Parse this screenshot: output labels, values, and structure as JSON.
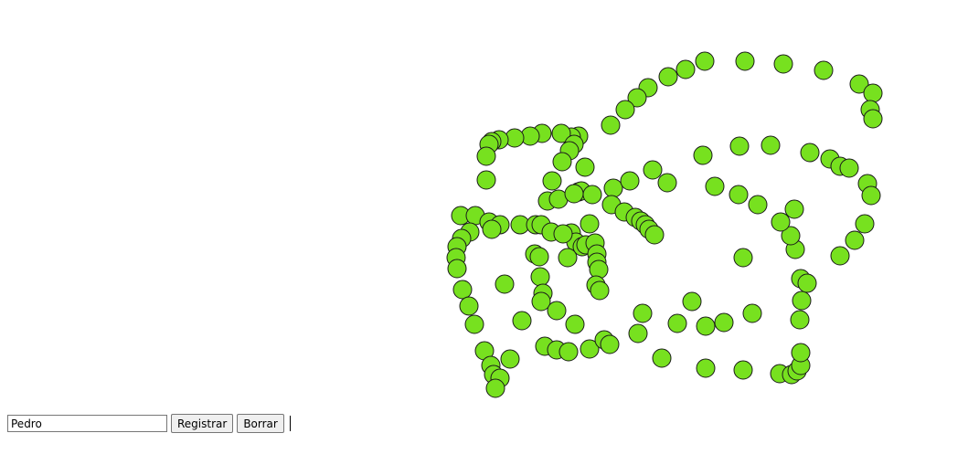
{
  "form": {
    "name_value": "Pedro",
    "register_label": "Registrar",
    "clear_label": "Borrar"
  },
  "canvas": {
    "dot_fill": "#77e11f",
    "dot_stroke": "#1a1a1a"
  }
}
